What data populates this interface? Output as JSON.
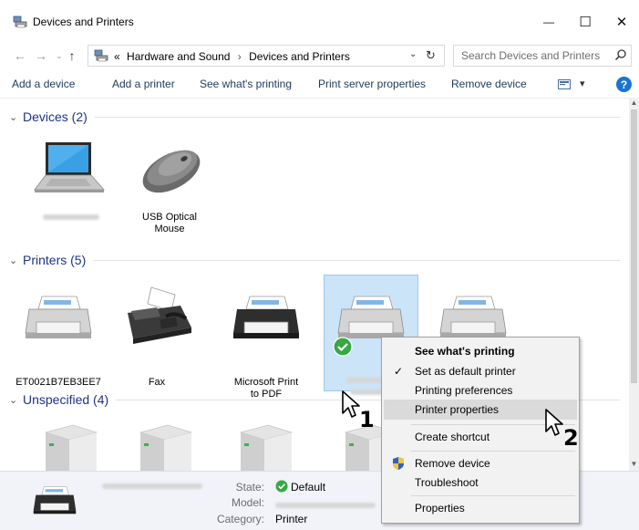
{
  "window": {
    "title": "Devices and Printers",
    "minimize_glyph": "—",
    "maximize_glyph": "☐",
    "close_glyph": "✕"
  },
  "address_bar": {
    "back_glyph": "←",
    "forward_glyph": "→",
    "recent_glyph": "⌄",
    "up_glyph": "↑",
    "prefix": "«",
    "crumbs": [
      "Hardware and Sound",
      "Devices and Printers"
    ],
    "separator": "›",
    "dropdown_glyph": "⌄",
    "refresh_glyph": "↻",
    "search_placeholder": "Search Devices and Printers"
  },
  "command_bar": {
    "add_device": "Add a device",
    "add_printer": "Add a printer",
    "see_printing": "See what's printing",
    "server_properties": "Print server properties",
    "remove_device": "Remove device",
    "view_dropdown_glyph": "▾",
    "help_glyph": "?"
  },
  "groups": {
    "devices": {
      "title": "Devices (2)",
      "chevron": "⌄"
    },
    "printers": {
      "title": "Printers (5)",
      "chevron": "⌄"
    },
    "unspecified": {
      "title": "Unspecified (4)",
      "chevron": "⌄"
    }
  },
  "devices": [
    {
      "name": "",
      "icon": "laptop-icon",
      "name_blurred": true
    },
    {
      "name_line1": "USB Optical",
      "name_line2": "Mouse",
      "icon": "mouse-icon"
    }
  ],
  "printers": [
    {
      "name": "ET0021B7EB3EE7",
      "icon": "printer-icon"
    },
    {
      "name": "Fax",
      "icon": "fax-icon"
    },
    {
      "name_line1": "Microsoft Print",
      "name_line2": "to PDF",
      "icon": "printer-icon"
    },
    {
      "name": "",
      "icon": "printer-icon",
      "selected": true,
      "default": true,
      "name_blurred": true
    },
    {
      "name": "",
      "icon": "printer-icon"
    }
  ],
  "details": {
    "state_label": "State:",
    "state_value": "Default",
    "model_label": "Model:",
    "category_label": "Category:",
    "category_value": "Printer"
  },
  "context_menu": {
    "items": [
      {
        "label": "See what's printing",
        "bold": true
      },
      {
        "label": "Set as default printer",
        "check": "✓"
      },
      {
        "label": "Printing preferences"
      },
      {
        "label": "Printer properties",
        "highlighted": true
      },
      {
        "label": "Create shortcut"
      },
      {
        "label": "Remove device",
        "icon": "shield-icon"
      },
      {
        "label": "Troubleshoot"
      },
      {
        "label": "Properties"
      }
    ]
  },
  "callouts": {
    "one": "1",
    "two": "2"
  },
  "colors": {
    "accent_blue": "#1e3287",
    "command_text": "#1e395b",
    "selection_fill": "#cce4f7",
    "default_badge": "#36a844",
    "help_blue": "#1b74d4"
  }
}
